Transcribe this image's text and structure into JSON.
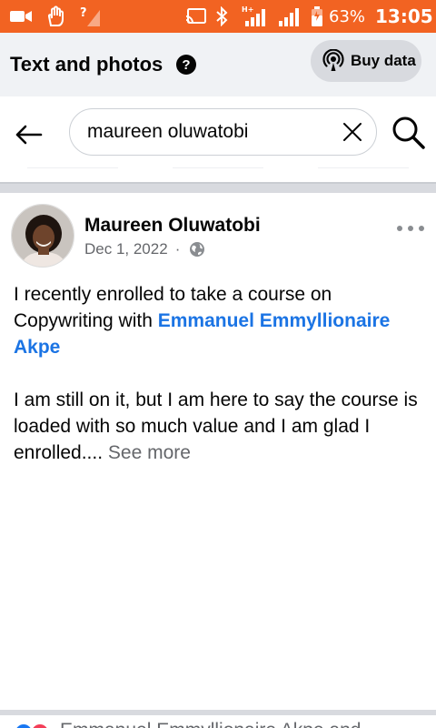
{
  "status_bar": {
    "battery": "63%",
    "time": "13:05",
    "icons": [
      "video-camera-icon",
      "hand-icon",
      "no-signal-icon",
      "cast-icon",
      "bluetooth-icon",
      "hplus-signal-icon",
      "signal-icon",
      "battery-icon"
    ]
  },
  "header": {
    "title": "Text and photos",
    "help_icon": "?",
    "buy_data_label": "Buy data"
  },
  "search": {
    "value": "maureen oluwatobi",
    "placeholder": "Search"
  },
  "post": {
    "author": "Maureen Oluwatobi",
    "date": "Dec 1, 2022",
    "separator": "·",
    "audience_icon": "globe-icon",
    "text_part1": "I recently enrolled to take a course on Copywriting with ",
    "mention": "Emmanuel Emmyllionaire Akpe",
    "text_part2": "I am still on it, but I am here to say the course is loaded with so much value and I am glad I enrolled....",
    "see_more": " See more"
  },
  "reactions": {
    "names": "Emmanuel Emmyllionaire Akpe and"
  },
  "colors": {
    "status_bar": "#f26322",
    "link": "#1b74e4",
    "header_bg": "#f0f2f5",
    "secondary_text": "#65676b"
  }
}
